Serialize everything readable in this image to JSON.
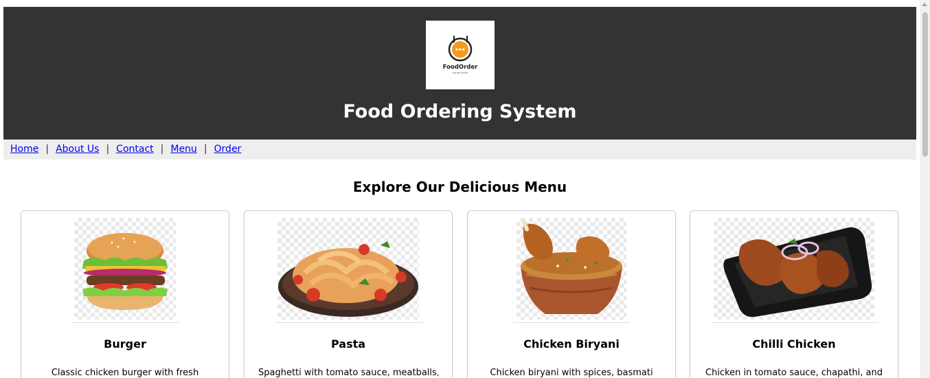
{
  "header": {
    "logo_text": "FoodOrder",
    "logo_tagline": "ONLINE ORDER",
    "title": "Food Ordering System"
  },
  "nav": {
    "items": [
      {
        "label": "Home"
      },
      {
        "label": "About Us"
      },
      {
        "label": "Contact"
      },
      {
        "label": "Menu"
      },
      {
        "label": "Order"
      }
    ],
    "separator": "|"
  },
  "menu": {
    "heading": "Explore Our Delicious Menu",
    "cards": [
      {
        "name": "Burger",
        "description": "Classic chicken burger with fresh",
        "image_icon": "burger-image"
      },
      {
        "name": "Pasta",
        "description": "Spaghetti with tomato sauce, meatballs,",
        "image_icon": "pasta-image"
      },
      {
        "name": "Chicken Biryani",
        "description": "Chicken biryani with spices, basmati",
        "image_icon": "biryani-image"
      },
      {
        "name": "Chilli Chicken",
        "description": "Chicken in tomato sauce, chapathi, and",
        "image_icon": "chilli-chicken-image"
      }
    ]
  },
  "colors": {
    "header_bg": "#333333",
    "nav_bg": "#eeeeee",
    "link": "#0000ee",
    "logo_orange": "#f39a1e"
  }
}
